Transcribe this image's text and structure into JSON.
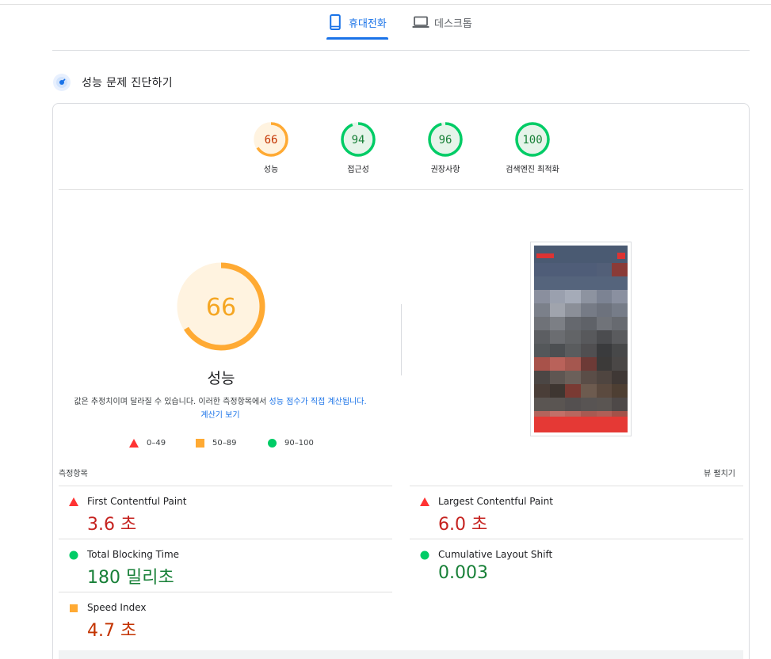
{
  "tabs": [
    {
      "label": "휴대전화",
      "icon": "smartphone-icon",
      "active": true
    },
    {
      "label": "데스크톱",
      "icon": "laptop-icon",
      "active": false
    }
  ],
  "diagnose": {
    "title": "성능 문제 진단하기",
    "icon": "lighthouse-icon"
  },
  "gauges": [
    {
      "score": "66",
      "label": "성능",
      "color": "#fa3",
      "fill": "#fff3e0",
      "text_color": "#c33300",
      "ratio": 0.66
    },
    {
      "score": "94",
      "label": "접근성",
      "color": "#0c6",
      "fill": "#e6f4ea",
      "text_color": "#188038",
      "ratio": 0.94
    },
    {
      "score": "96",
      "label": "권장사항",
      "color": "#0c6",
      "fill": "#e6f4ea",
      "text_color": "#188038",
      "ratio": 0.96
    },
    {
      "score": "100",
      "label": "검색엔진 최적화",
      "color": "#0c6",
      "fill": "#e6f4ea",
      "text_color": "#188038",
      "ratio": 1.0
    }
  ],
  "performance": {
    "score": "66",
    "ratio": 0.66,
    "label": "성능",
    "desc_prefix": "값은 추정치이며 달라질 수 있습니다. 이러한 측정항목에서 ",
    "desc_link1": "성능 점수가 직접 계산됩니다.",
    "desc_link2": "계산기 보기"
  },
  "legend": [
    {
      "range": "0–49",
      "shape": "triangle",
      "color": "#f33"
    },
    {
      "range": "50–89",
      "shape": "square",
      "color": "#fa3"
    },
    {
      "range": "90–100",
      "shape": "circle",
      "color": "#0c6"
    }
  ],
  "metrics_header": {
    "title": "측정항목",
    "expand": "뷰 펼치기"
  },
  "metrics": [
    {
      "name": "First Contentful Paint",
      "value": "3.6 초",
      "status": "red"
    },
    {
      "name": "Largest Contentful Paint",
      "value": "6.0 초",
      "status": "red"
    },
    {
      "name": "Total Blocking Time",
      "value": "180 밀리초",
      "status": "green"
    },
    {
      "name": "Cumulative Layout Shift",
      "value": "0.003",
      "status": "green"
    },
    {
      "name": "Speed Index",
      "value": "4.7 초",
      "status": "orange"
    }
  ],
  "screenshot_colors": [
    "#4f5d78",
    "#4f5d78",
    "#4f5d78",
    "#4f5d78",
    "#525f78",
    "#8a3b38",
    "#55647c",
    "#55647c",
    "#55647c",
    "#55647c",
    "#55647c",
    "#55647c",
    "#8a8f9e",
    "#9aa0ae",
    "#a5abb8",
    "#8d93a0",
    "#7c8393",
    "#8a90a0",
    "#7b808a",
    "#a0a4ad",
    "#8b8f98",
    "#767b86",
    "#6d727d",
    "#767c88",
    "#6f7278",
    "#7c7f85",
    "#65686e",
    "#5f6268",
    "#707379",
    "#676a70",
    "#5c5e62",
    "#6b6d71",
    "#626467",
    "#58595c",
    "#4b4c4f",
    "#5a5b5e",
    "#54575a",
    "#4c4f52",
    "#5a5c5e",
    "#504f51",
    "#3a3b3d",
    "#474849",
    "#a8524a",
    "#b9625a",
    "#a5574f",
    "#6d3a36",
    "#3c3a39",
    "#4a4746",
    "#4b4644",
    "#5e5652",
    "#6b605a",
    "#5a4d47",
    "#4f4540",
    "#3f3835",
    "#4a3e38",
    "#3e3631",
    "#7a3a33",
    "#6d5b4f",
    "#5b4a3f",
    "#4e3f33",
    "#5a5552",
    "#5a5552",
    "#545050",
    "#585453",
    "#5a5552",
    "#4e4948",
    "#b4645c",
    "#c27068",
    "#b8675f",
    "#a85a52",
    "#b05f57",
    "#a35249"
  ]
}
